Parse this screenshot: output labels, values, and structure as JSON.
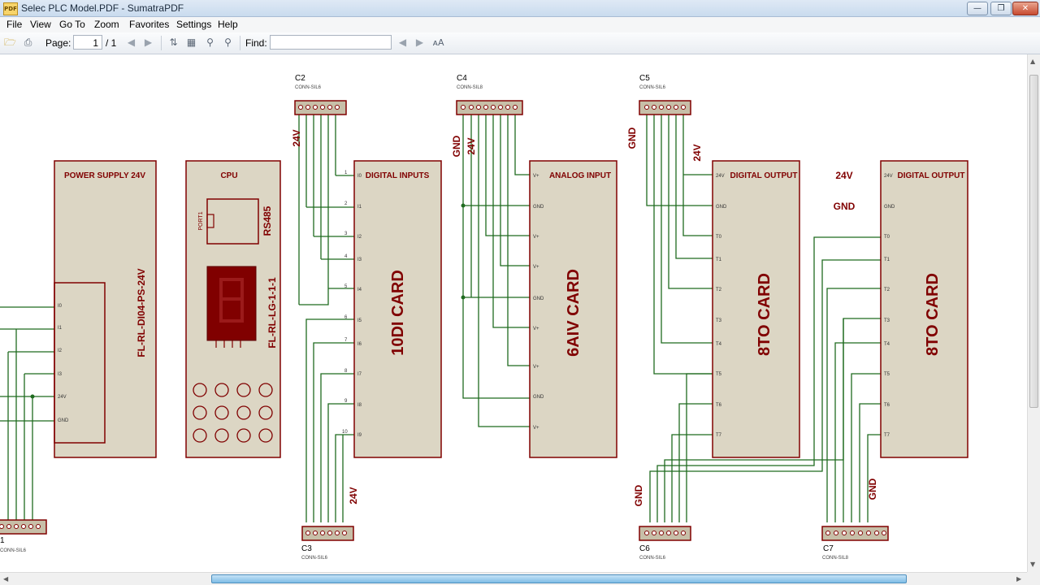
{
  "window": {
    "title": "Selec PLC Model.PDF - SumatraPDF",
    "app_icon_label": "PDF",
    "min_symbol": "—",
    "max_symbol": "❐",
    "close_symbol": "✕"
  },
  "menu": {
    "items": [
      {
        "label": "File"
      },
      {
        "label": "View"
      },
      {
        "label": "Go To"
      },
      {
        "label": "Zoom"
      },
      {
        "label": "Favorites"
      },
      {
        "label": "Settings"
      },
      {
        "label": "Help"
      }
    ]
  },
  "toolbar": {
    "page_label": "Page:",
    "page_value": "1",
    "page_total": "/ 1",
    "find_label": "Find:",
    "find_value": "",
    "icons": [
      "open-icon",
      "print-icon",
      "prev-page-icon",
      "next-page-icon",
      "fit-page-icon",
      "fit-width-icon",
      "zoom-out-icon",
      "zoom-in-icon",
      "find-prev-icon",
      "find-next-icon",
      "match-case-icon"
    ]
  },
  "colors": {
    "module_fill": "#dcd6c4",
    "module_stroke": "#800000",
    "text_red": "#800000",
    "wire": "#1f6b1f",
    "connector_fill": "#c7bfa8",
    "display_fill": "#800000"
  },
  "schematic": {
    "modules": {
      "power": {
        "title": "POWER SUPPLY 24V",
        "label": "FL-RL-DI04-PS-24V"
      },
      "cpu": {
        "title": "CPU",
        "label": "FL-RL-LG-1-1-1",
        "port": "PORT1",
        "rs485": "RS485"
      },
      "di": {
        "title": "DIGITAL INPUTS",
        "label": "10DI CARD"
      },
      "ai": {
        "title": "ANALOG INPUT",
        "label": "6AIV CARD"
      },
      "do1": {
        "title": "DIGITAL OUTPUT",
        "label": "8TO CARD"
      },
      "do2": {
        "title": "DIGITAL OUTPUT",
        "label": "8TO CARD"
      }
    },
    "connectors": {
      "c2": {
        "ref": "C2",
        "part": "CONN-SIL6"
      },
      "c4": {
        "ref": "C4",
        "part": "CONN-SIL8"
      },
      "c5": {
        "ref": "C5",
        "part": "CONN-SIL6"
      },
      "c3": {
        "ref": "C3",
        "part": "CONN-SIL6"
      },
      "c6": {
        "ref": "C6",
        "part": "CONN-SIL6"
      },
      "c7": {
        "ref": "C7",
        "part": "CONN-SIL8"
      },
      "c1": {
        "ref": "1",
        "part": "CONN-SIL6"
      }
    },
    "net_labels": {
      "v24": "24V",
      "gnd": "GND"
    },
    "power_pins": [
      "I0",
      "I1",
      "I2",
      "I3",
      "24V",
      "GND"
    ],
    "di_pins": [
      "I0",
      "I1",
      "I2",
      "I3",
      "I4",
      "I5",
      "I6",
      "I7",
      "I8",
      "I9"
    ],
    "ai_pins": [
      "V+",
      "GND",
      "V+",
      "V+",
      "GND",
      "V+",
      "V+",
      "GND",
      "V+"
    ],
    "do_pins": [
      "24V",
      "GND",
      "T0",
      "T1",
      "T2",
      "T3",
      "T4",
      "T5",
      "T6",
      "T7"
    ],
    "pin_numbers": [
      "1",
      "2",
      "3",
      "4",
      "5",
      "6",
      "7",
      "8",
      "9",
      "10"
    ]
  }
}
